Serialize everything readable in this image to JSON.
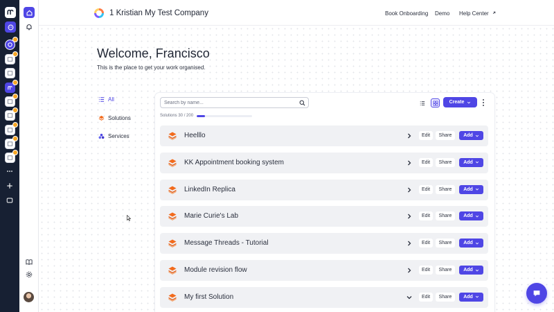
{
  "topbar": {
    "company_name": "1 Kristian My Test Company",
    "nav": [
      "Book Onboarding",
      "Demo",
      "Help Center"
    ]
  },
  "welcome": {
    "title": "Welcome, Francisco",
    "subtitle": "This is the place to get your work organised."
  },
  "side_menu": {
    "items": [
      {
        "label": "All",
        "icon": "list-icon",
        "active": true
      },
      {
        "label": "Solutions",
        "icon": "layers-icon",
        "active": false
      },
      {
        "label": "Services",
        "icon": "services-icon",
        "active": false
      }
    ]
  },
  "toolbar": {
    "search_placeholder": "Search by name...",
    "create_label": "Create"
  },
  "solutions_count": {
    "label": "Solutions 30 / 200",
    "used": 30,
    "max": 200
  },
  "row_actions": {
    "edit": "Edit",
    "share": "Share",
    "add": "Add"
  },
  "solutions": [
    {
      "name": "Heelllo",
      "expanded": false
    },
    {
      "name": "KK Appointment booking system",
      "expanded": false
    },
    {
      "name": "LinkedIn Replica",
      "expanded": false
    },
    {
      "name": "Marie Curie's Lab",
      "expanded": false
    },
    {
      "name": "Message Threads - Tutorial",
      "expanded": false
    },
    {
      "name": "Module revision flow",
      "expanded": false
    },
    {
      "name": "My first Solution",
      "expanded": true
    }
  ],
  "colors": {
    "accent": "#4f46e5",
    "rail_dark": "#172033",
    "row_bg": "#f0f1f4",
    "badge": "#f5a524",
    "solution_icon": "#f26b1d"
  }
}
